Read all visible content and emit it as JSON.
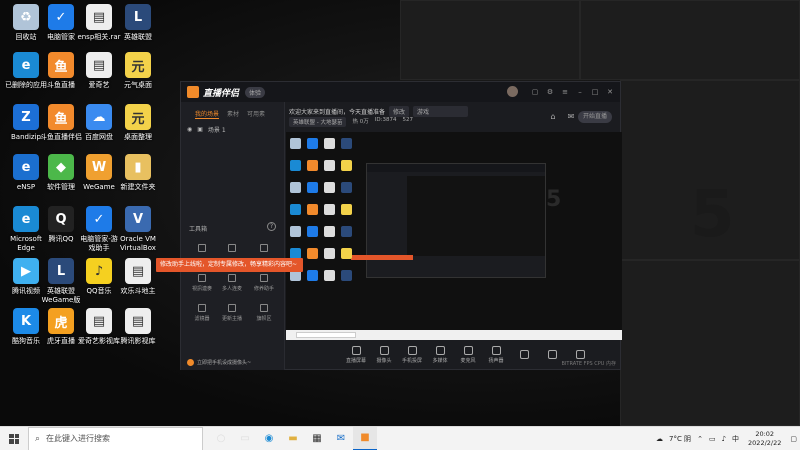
{
  "desktop": {
    "icons": [
      {
        "label": "回收站",
        "name": "recycle-bin-icon",
        "color": "#b0c4d8",
        "glyph": "♻"
      },
      {
        "label": "电脑管家",
        "name": "pc-manager-icon",
        "color": "#1e7be8",
        "glyph": "✓"
      },
      {
        "label": "ensp相关.rar",
        "name": "rar-file-icon",
        "color": "#eeeeee",
        "glyph": "▤"
      },
      {
        "label": "英雄联盟",
        "name": "lol-icon",
        "color": "#2b4a7a",
        "glyph": "L"
      },
      {
        "label": "已删除的应用",
        "name": "edge-deleted-icon",
        "color": "#1a8ad4",
        "glyph": "e"
      },
      {
        "label": "斗鱼直播",
        "name": "douyu-icon",
        "color": "#f28a2c",
        "glyph": "鱼"
      },
      {
        "label": "爱奇艺",
        "name": "iqiyi-file-icon",
        "color": "#eeeeee",
        "glyph": "▤"
      },
      {
        "label": "元气桌面",
        "name": "yuanqi-icon",
        "color": "#f3d24a",
        "glyph": "元"
      },
      {
        "label": "Bandizip",
        "name": "bandizip-icon",
        "color": "#1c6fd6",
        "glyph": "Z"
      },
      {
        "label": "斗鱼直播伴侣",
        "name": "douyu-companion-icon",
        "color": "#f28a2c",
        "glyph": "鱼"
      },
      {
        "label": "百度网盘",
        "name": "baidu-pan-icon",
        "color": "#3a8bf0",
        "glyph": "☁"
      },
      {
        "label": "桌面整理",
        "name": "desktop-organizer-icon",
        "color": "#f3d24a",
        "glyph": "元"
      },
      {
        "label": "eNSP",
        "name": "ensp-icon",
        "color": "#1b6fcf",
        "glyph": "e"
      },
      {
        "label": "软件管理",
        "name": "software-manager-icon",
        "color": "#4cb84a",
        "glyph": "◆"
      },
      {
        "label": "WeGame",
        "name": "wegame-icon",
        "color": "#f0a030",
        "glyph": "W"
      },
      {
        "label": "新建文件夹",
        "name": "new-folder-icon",
        "color": "#e8c060",
        "glyph": "▮"
      },
      {
        "label": "Microsoft Edge",
        "name": "edge-icon",
        "color": "#1a8ad4",
        "glyph": "e"
      },
      {
        "label": "腾讯QQ",
        "name": "qq-icon",
        "color": "#222222",
        "glyph": "Q"
      },
      {
        "label": "电脑管家-游戏助手",
        "name": "game-assistant-icon",
        "color": "#1e7be8",
        "glyph": "✓"
      },
      {
        "label": "Oracle VM VirtualBox",
        "name": "virtualbox-icon",
        "color": "#3a6ab0",
        "glyph": "V"
      },
      {
        "label": "腾讯视频",
        "name": "tencent-video-icon",
        "color": "#3fb0f0",
        "glyph": "▶"
      },
      {
        "label": "英雄联盟WeGame版",
        "name": "lol-wegame-icon",
        "color": "#2b4a7a",
        "glyph": "L"
      },
      {
        "label": "QQ音乐",
        "name": "qq-music-icon",
        "color": "#f5d020",
        "glyph": "♪"
      },
      {
        "label": "欢乐斗地主",
        "name": "ddz-file-icon",
        "color": "#eeeeee",
        "glyph": "▤"
      },
      {
        "label": "酷狗音乐",
        "name": "kugou-icon",
        "color": "#1c8ae8",
        "glyph": "K"
      },
      {
        "label": "虎牙直播",
        "name": "huya-icon",
        "color": "#f4a020",
        "glyph": "虎"
      },
      {
        "label": "爱奇艺影视库",
        "name": "iqiyi-lib-file-icon",
        "color": "#eeeeee",
        "glyph": "▤"
      },
      {
        "label": "腾讯影视库",
        "name": "tencent-lib-file-icon",
        "color": "#eeeeee",
        "glyph": "▤"
      }
    ]
  },
  "app": {
    "title": "直播伴侣",
    "badge": "体验",
    "tabs": [
      "我的场景",
      "素材",
      "可用素"
    ],
    "scene_label": "场景 1",
    "topline": "欢迎大家来到直播间，今天直播准备",
    "topline_pill": "修改",
    "topline_input": "游戏",
    "row2": [
      "英雄联盟 - 大地瑟苗",
      "热 0万",
      "ID:3874",
      "527"
    ],
    "tools_title": "工具箱",
    "tools": [
      {
        "label": "",
        "name": "tool-1"
      },
      {
        "label": "",
        "name": "tool-2"
      },
      {
        "label": "",
        "name": "tool-3"
      },
      {
        "label": "視訊連麥",
        "name": "tool-video-link"
      },
      {
        "label": "多人连麦",
        "name": "tool-multi-link"
      },
      {
        "label": "修养助手",
        "name": "tool-assistant"
      },
      {
        "label": "滤镜器",
        "name": "tool-filter"
      },
      {
        "label": "更新主播",
        "name": "tool-update"
      },
      {
        "label": "旗帜区",
        "name": "tool-banner"
      }
    ],
    "tooltip": "修改助手上线啦，定制专属修改，畅享精彩内容吧~",
    "promo": "立即把手机设成摄像头~",
    "controls": [
      "直播屏幕",
      "摄像头",
      "手机投屏",
      "多媒体",
      "麦克风",
      "扬声器",
      "",
      "",
      ""
    ],
    "go_live": "开始直播",
    "status": "BITRATE  FPS  CPU  内存"
  },
  "taskbar": {
    "search_placeholder": "在此键入进行搜索",
    "weather": "7°C 阴",
    "lang": "中",
    "time": "20:02",
    "date": "2022/2/22"
  },
  "colors": {
    "accent": "#f08a2a",
    "tooltip": "#e4562a"
  }
}
